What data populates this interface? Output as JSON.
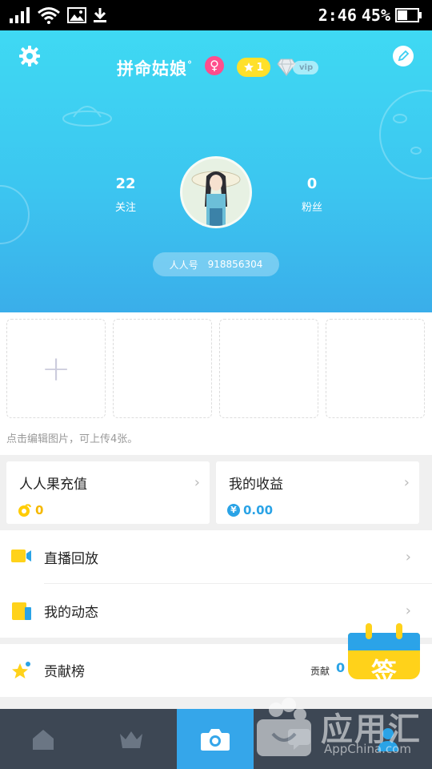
{
  "status_bar": {
    "time": "2:46",
    "battery": "45%",
    "icons": [
      "signal-icon",
      "wifi-icon",
      "image-icon",
      "download-icon",
      "battery-icon"
    ]
  },
  "profile": {
    "nickname": "拼命姑娘",
    "nickname_mark": "°",
    "gender_symbol": "♀",
    "level": "1",
    "vip_label": "vip",
    "following_count": "22",
    "following_label": "关注",
    "fans_count": "0",
    "fans_label": "粉丝",
    "id_label": "人人号",
    "id_value": "918856304"
  },
  "photos": {
    "add_symbol": "+",
    "hint": "点击编辑图片，可上传4张。"
  },
  "cards": {
    "recharge": {
      "title": "人人果充值",
      "value": "0"
    },
    "earnings": {
      "title": "我的收益",
      "currency": "¥",
      "value": "0.00"
    }
  },
  "menu": {
    "replay": "直播回放",
    "dynamics": "我的动态"
  },
  "contribution": {
    "title": "贡献榜",
    "label": "贡献",
    "value": "0"
  },
  "sign_in": {
    "label": "签"
  },
  "watermark": {
    "title": "应用汇",
    "subtitle": "AppChina.com"
  },
  "colors": {
    "header_top": "#3fd9f3",
    "header_bottom": "#3aaeea",
    "tabbar_bg": "#3d4754",
    "tab_active": "#35a6ea",
    "accent_yellow": "#ffd21a",
    "accent_blue": "#2aa3e6"
  }
}
